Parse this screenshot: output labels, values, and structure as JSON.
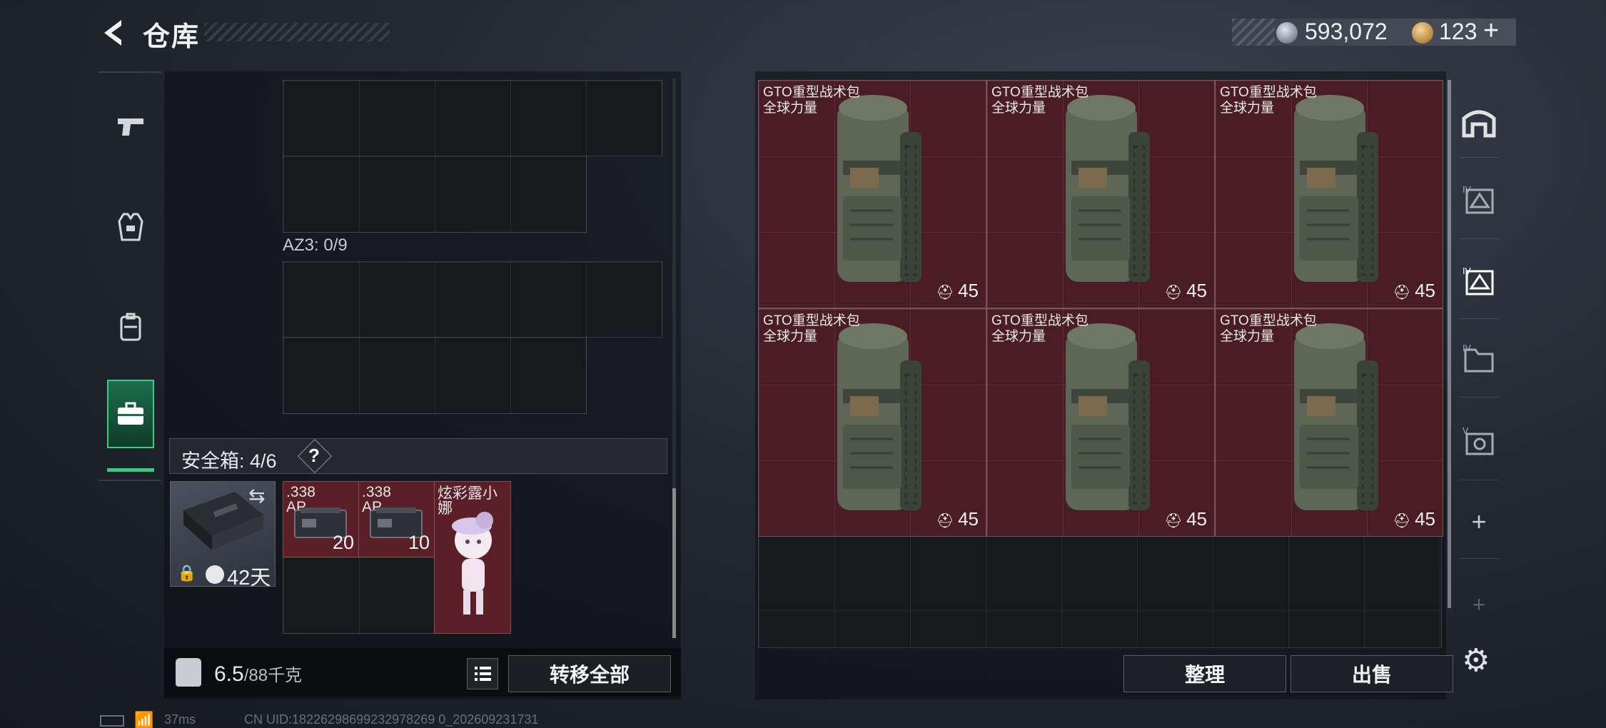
{
  "header": {
    "title": "仓库",
    "money": "593,072",
    "tokens": "123",
    "plus_label": "+"
  },
  "left_tabs": [
    "pistol-icon",
    "vest-icon",
    "backpack-icon",
    "case-icon"
  ],
  "left_panel": {
    "container_label": "AZ3: 0/9",
    "safe_box": {
      "title": "安全箱: 4/6",
      "help": "?",
      "days_left": "42天",
      "items": [
        {
          "label": ".338\nAP",
          "count": "20"
        },
        {
          "label": ".338\nAP",
          "count": "10"
        },
        {
          "label": "炫彩露小娜",
          "count": ""
        }
      ]
    },
    "weight_current": "6.5",
    "weight_total": "/88千克",
    "transfer_all": "转移全部"
  },
  "stash": {
    "items": [
      {
        "name": "GTO重型战术包",
        "tag": "全球力量",
        "count": "45"
      },
      {
        "name": "GTO重型战术包",
        "tag": "全球力量",
        "count": "45"
      },
      {
        "name": "GTO重型战术包",
        "tag": "全球力量",
        "count": "45"
      },
      {
        "name": "GTO重型战术包",
        "tag": "全球力量",
        "count": "45"
      },
      {
        "name": "GTO重型战术包",
        "tag": "全球力量",
        "count": "45"
      },
      {
        "name": "GTO重型战术包",
        "tag": "全球力量",
        "count": "45"
      }
    ],
    "sort_label": "整理",
    "sell_label": "出售"
  },
  "right_tabs": {
    "plus_label": "+"
  },
  "status": {
    "ping": "37ms",
    "uid": "CN UID:18226298699232978269 0_202609231731"
  },
  "colors": {
    "accent_green": "#3acc86",
    "item_red": "#4a1d25"
  }
}
